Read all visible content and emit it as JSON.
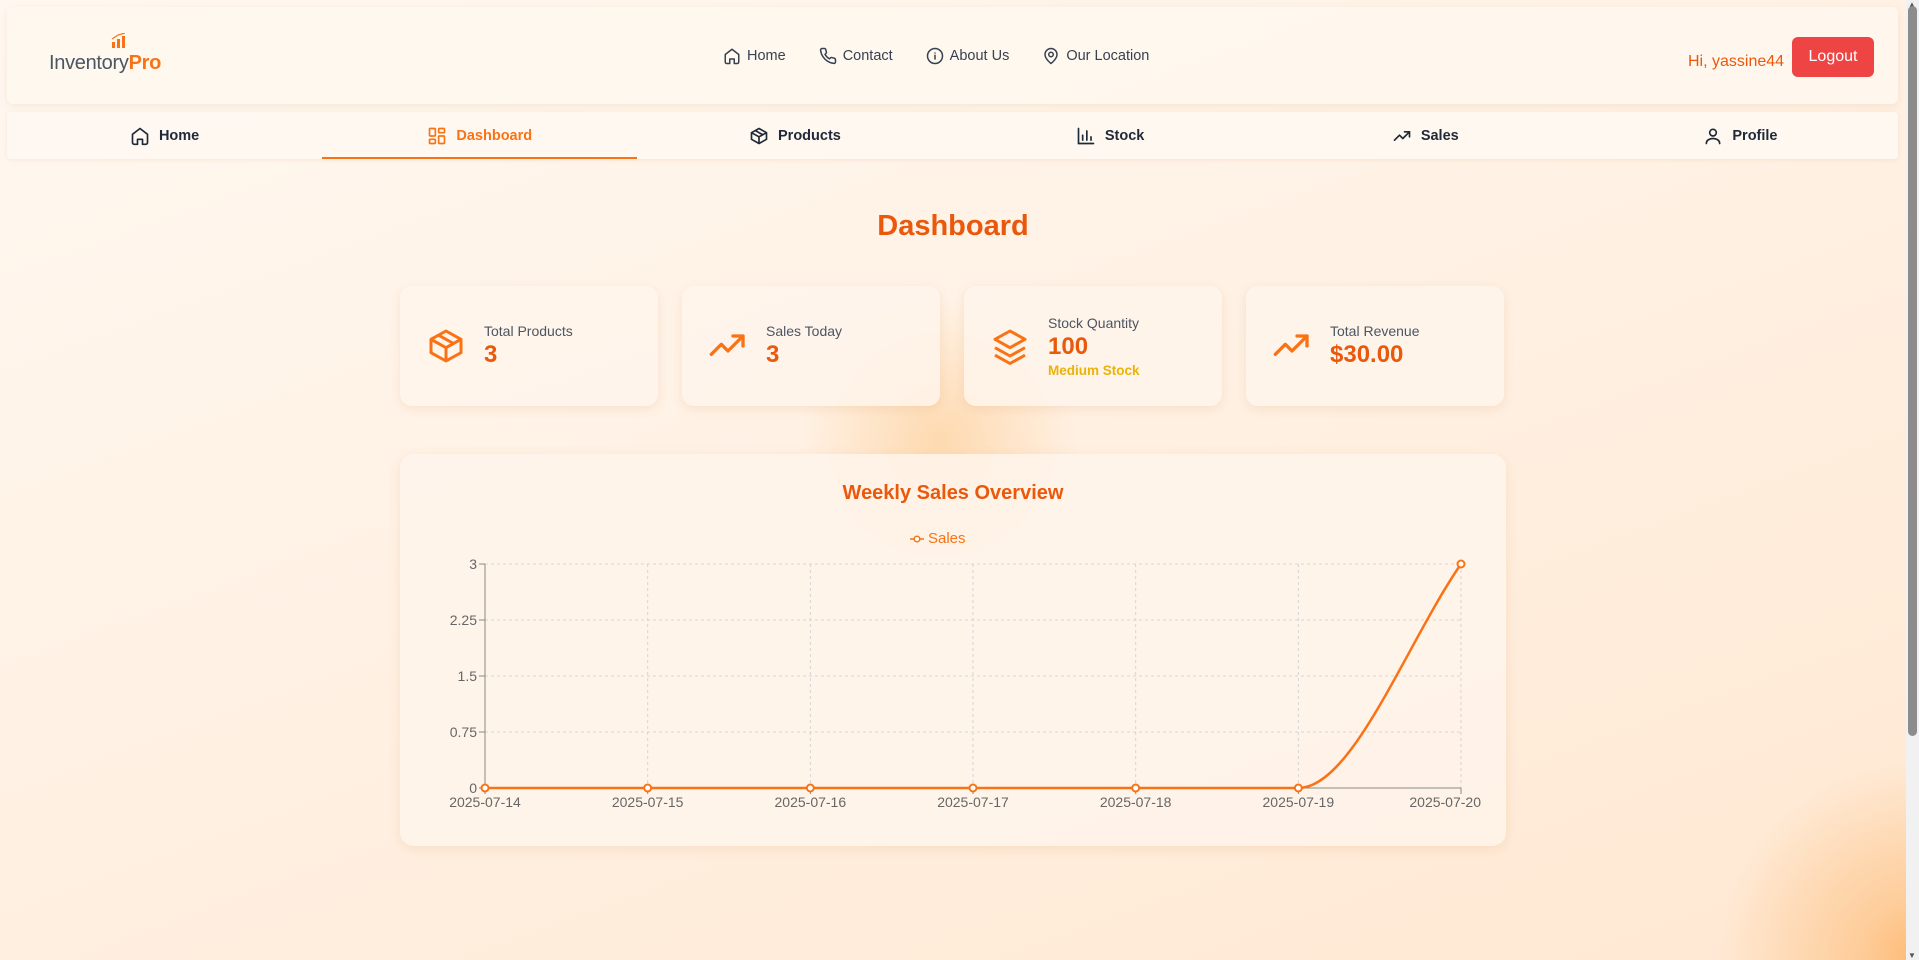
{
  "header": {
    "logo": {
      "part1": "Inventory",
      "part2": "Pro"
    },
    "links": [
      {
        "label": "Home",
        "icon": "home-icon"
      },
      {
        "label": "Contact",
        "icon": "phone-icon"
      },
      {
        "label": "About Us",
        "icon": "info-icon"
      },
      {
        "label": "Our Location",
        "icon": "map-pin-icon"
      }
    ],
    "greeting": "Hi, yassine44",
    "logout_label": "Logout"
  },
  "tabs": [
    {
      "label": "Home",
      "icon": "home-icon",
      "active": false
    },
    {
      "label": "Dashboard",
      "icon": "dashboard-icon",
      "active": true
    },
    {
      "label": "Products",
      "icon": "box-icon",
      "active": false
    },
    {
      "label": "Stock",
      "icon": "bar-chart-icon",
      "active": false
    },
    {
      "label": "Sales",
      "icon": "trending-up-icon",
      "active": false
    },
    {
      "label": "Profile",
      "icon": "user-icon",
      "active": false
    }
  ],
  "page": {
    "title": "Dashboard"
  },
  "stats": {
    "total_products": {
      "label": "Total Products",
      "value": "3",
      "icon": "box-icon"
    },
    "sales_today": {
      "label": "Sales Today",
      "value": "3",
      "icon": "trending-up-icon"
    },
    "stock_quantity": {
      "label": "Stock Quantity",
      "value": "100",
      "sub": "Medium Stock",
      "icon": "layers-icon"
    },
    "total_revenue": {
      "label": "Total Revenue",
      "value": "$30.00",
      "icon": "trending-up-icon"
    }
  },
  "colors": {
    "accent": "#f97316",
    "accent_dark": "#ea580c",
    "logout": "#ef4444",
    "warning": "#eab308"
  },
  "chart_data": {
    "type": "line",
    "title": "Weekly Sales Overview",
    "categories": [
      "2025-07-14",
      "2025-07-15",
      "2025-07-16",
      "2025-07-17",
      "2025-07-18",
      "2025-07-19",
      "2025-07-20"
    ],
    "series": [
      {
        "name": "Sales",
        "values": [
          0,
          0,
          0,
          0,
          0,
          0,
          3
        ]
      }
    ],
    "ylim": [
      0,
      3
    ],
    "yticks": [
      "0",
      "0.75",
      "1.5",
      "2.25",
      "3"
    ],
    "grid": true,
    "legend": "top-center"
  }
}
